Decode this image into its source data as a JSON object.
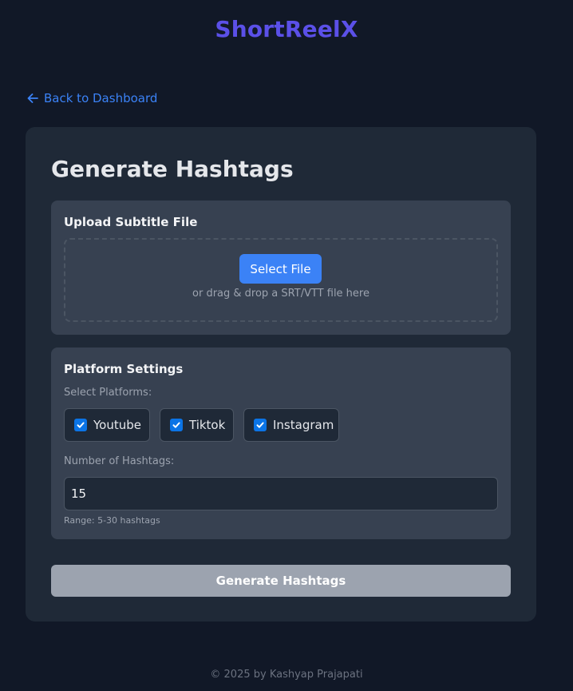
{
  "app": {
    "brand": "ShortReelX",
    "brand_color": "#5b50e8"
  },
  "nav": {
    "back_label": "Back to Dashboard",
    "back_icon": "arrow-left-icon"
  },
  "page": {
    "title": "Generate Hashtags"
  },
  "upload": {
    "title": "Upload Subtitle File",
    "button_label": "Select File",
    "hint": "or drag & drop a SRT/VTT file here"
  },
  "platform": {
    "title": "Platform Settings",
    "select_label": "Select Platforms:",
    "options": [
      {
        "label": "Youtube",
        "checked": true
      },
      {
        "label": "Tiktok",
        "checked": true
      },
      {
        "label": "Instagram",
        "checked": true
      }
    ],
    "count_label": "Number of Hashtags:",
    "count_value": "15",
    "range_hint": "Range: 5-30 hashtags"
  },
  "actions": {
    "generate_label": "Generate Hashtags"
  },
  "footer": {
    "text": "© 2025 by Kashyap Prajapati"
  },
  "colors": {
    "background": "#111827",
    "card": "#1f2937",
    "section": "#374151",
    "accent": "#3b82f6",
    "disabled_button": "#9ca3af"
  }
}
